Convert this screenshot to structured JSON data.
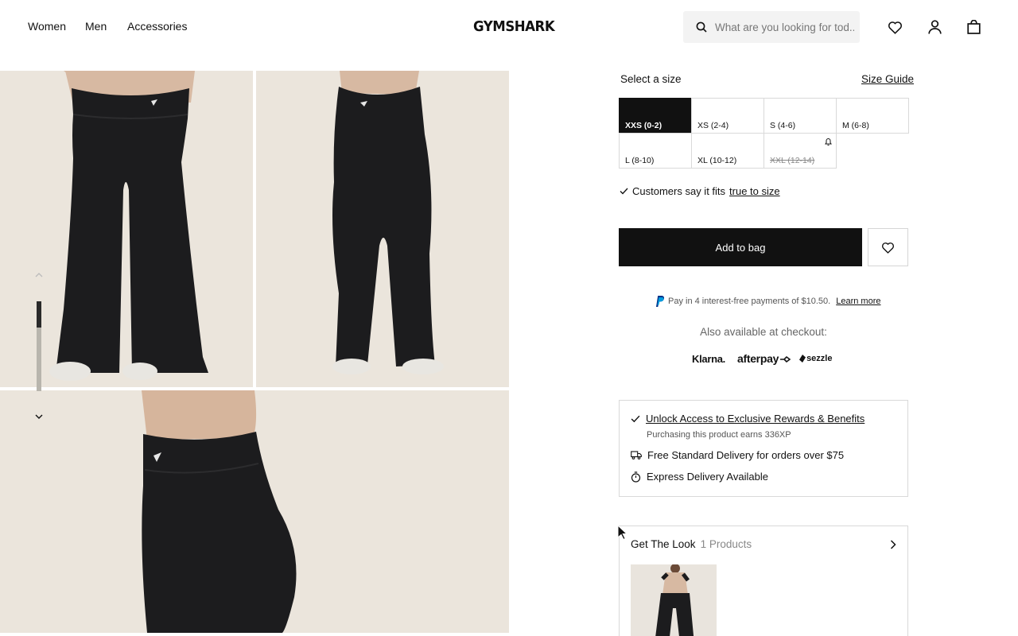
{
  "header": {
    "nav": [
      "Women",
      "Men",
      "Accessories"
    ],
    "logo": "GYMSHARK",
    "search_placeholder": "What are you looking for tod..."
  },
  "product": {
    "select_size_label": "Select a size",
    "size_guide_label": "Size Guide",
    "sizes": [
      {
        "label": "XXS (0-2)",
        "state": "selected"
      },
      {
        "label": "XS (2-4)",
        "state": "available"
      },
      {
        "label": "S (4-6)",
        "state": "available"
      },
      {
        "label": "M (6-8)",
        "state": "available"
      },
      {
        "label": "L (8-10)",
        "state": "available"
      },
      {
        "label": "XL (10-12)",
        "state": "available"
      },
      {
        "label": "XXL (12-14)",
        "state": "unavailable"
      }
    ],
    "fit_text": "Customers say it fits",
    "fit_link": "true to size",
    "add_to_bag_label": "Add to bag",
    "paypal_text": "Pay in 4 interest-free payments of $10.50.",
    "paypal_learn_more": "Learn more",
    "also_available": "Also available at checkout:",
    "payment_providers": [
      "Klarna.",
      "afterpay",
      "sezzle"
    ]
  },
  "benefits": {
    "rewards_link": "Unlock Access to Exclusive Rewards & Benefits",
    "rewards_sub": "Purchasing this product earns 336XP",
    "delivery_standard": "Free Standard Delivery for orders over $75",
    "delivery_express": "Express Delivery Available"
  },
  "get_the_look": {
    "title": "Get The Look",
    "count": "1 Products"
  },
  "colors": {
    "primary": "#111111",
    "border": "#d9d9d9",
    "photo_background": "#ebe5dc",
    "leggings": "#1c1c1e"
  }
}
